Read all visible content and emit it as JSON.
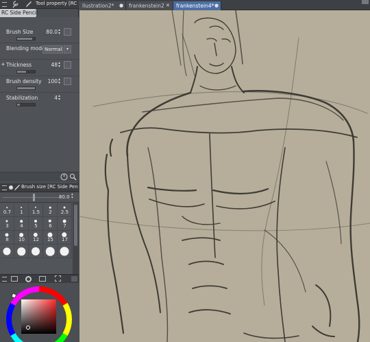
{
  "tool_property": {
    "title": "Tool property [RC S",
    "sub_tool": "RC Side Pencil",
    "params": [
      {
        "label": "Brush Size",
        "value": "80.0"
      },
      {
        "label": "Blending mode",
        "value": "Normal"
      },
      {
        "label": "Thickness",
        "value": "48"
      },
      {
        "label": "Brush density",
        "value": "100"
      },
      {
        "label": "Stabilization",
        "value": "4"
      }
    ]
  },
  "brush_size": {
    "title": "Brush size [RC Side Pencil]",
    "value": "80.0",
    "presets": [
      "0.7",
      "1",
      "1.5",
      "2",
      "2.5",
      "3",
      "4",
      "5",
      "6",
      "7",
      "8",
      "10",
      "12",
      "15",
      "17"
    ],
    "bottom_row_visible": true
  },
  "tabs": [
    {
      "label": "llustration2*",
      "active": false
    },
    {
      "label": "frankenstein2",
      "active": false
    },
    {
      "label": "frankenstein4*",
      "active": true
    }
  ],
  "colors": {
    "canvas_bg": "#b6ae9a",
    "active_tab": "#4c6fa5",
    "panel_bg": "#4b4e53",
    "main_color": "#f2f2f2"
  },
  "icons": [
    "wrench-icon",
    "pencil-icon",
    "lock-icon",
    "dial-icon",
    "search-icon",
    "settings-icon",
    "color-wheel-icon"
  ]
}
